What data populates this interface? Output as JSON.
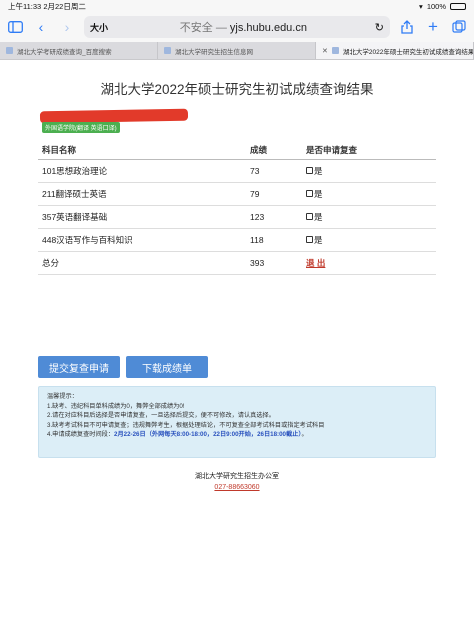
{
  "status": {
    "time": "上午11:33",
    "date": "2月22日周二",
    "battery": "100%"
  },
  "toolbar": {
    "text_size": "大小",
    "insecure": "不安全 —",
    "domain": "yjs.hubu.edu.cn"
  },
  "tabs": [
    {
      "label": "湖北大学考研成绩查询_百度搜索"
    },
    {
      "label": "湖北大学研究生招生信息网"
    },
    {
      "label": "湖北大学2022年硕士研究生初试成绩查询结果"
    }
  ],
  "page": {
    "title": "湖北大学2022年硕士研究生初试成绩查询结果",
    "badge": "外国语学院(翻译 英语口译)"
  },
  "table": {
    "headers": [
      "科目名称",
      "成绩",
      "是否申请复查"
    ],
    "rows": [
      {
        "subject": "101思想政治理论",
        "score": "73",
        "recheck": "是"
      },
      {
        "subject": "211翻译硕士英语",
        "score": "79",
        "recheck": "是"
      },
      {
        "subject": "357英语翻译基础",
        "score": "123",
        "recheck": "是"
      },
      {
        "subject": "448汉语写作与百科知识",
        "score": "118",
        "recheck": "是"
      }
    ],
    "total_label": "总分",
    "total_score": "393",
    "logout": "退 出"
  },
  "buttons": {
    "submit": "提交复查申请",
    "download": "下载成绩单"
  },
  "notice": {
    "title": "温馨提示：",
    "line1": "1.缺考、违纪科目单科成绩为0，舞弊全部成绩为0!",
    "line2": "2.请在对应科目后选择是否申请复查，一旦选择后提交，便不可修改，请认真选择。",
    "line3": "3.缺考考试科目不可申请复查；违规舞弊考生，根据处理结论，不可复查全部考试科目或指定考试科目",
    "line4_prefix": "4.申请成绩复查时间段：",
    "line4_highlight": "2月22-26日（外网每天8:00-18:00，22日9:00开始，26日18:00截止）",
    "line4_suffix": "。"
  },
  "footer": {
    "office": "湖北大学研究生招生办公室",
    "phone": "027-88663060"
  },
  "colors": {
    "accent": "#4f8bd6",
    "notice_bg": "#dceef7",
    "link_red": "#c0392b"
  }
}
